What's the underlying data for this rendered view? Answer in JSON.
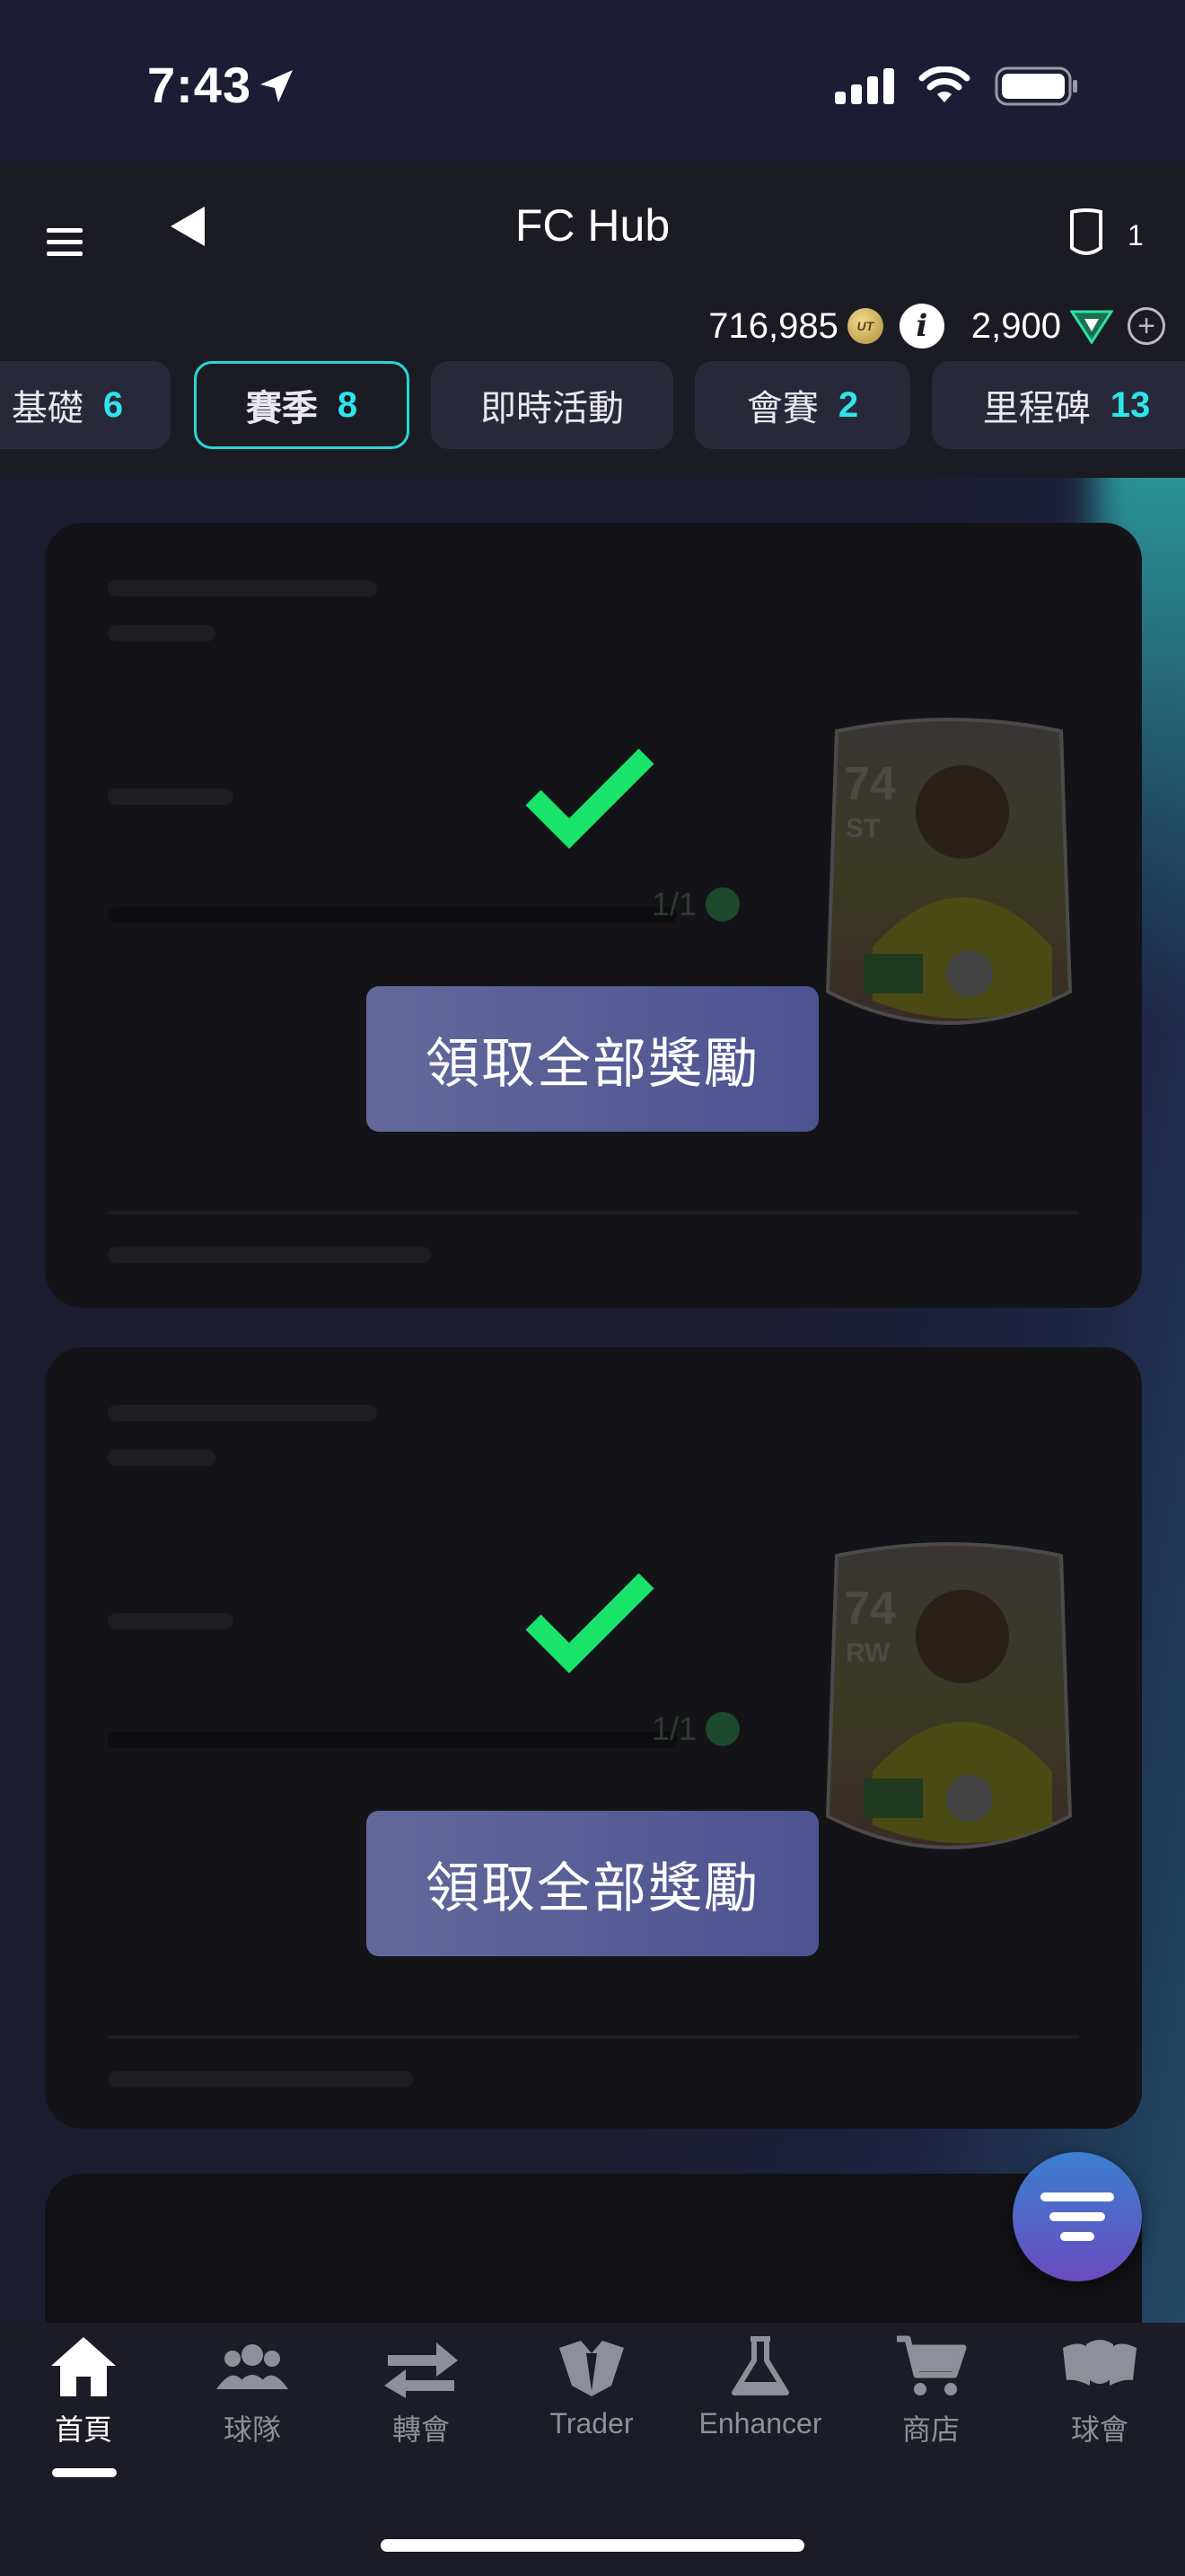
{
  "status_bar": {
    "time": "7:43"
  },
  "header": {
    "title": "FC Hub",
    "shield_count": "1"
  },
  "currency": {
    "coins": "716,985",
    "points": "2,900",
    "coin_icon_text": "UT"
  },
  "tabs": [
    {
      "label": "基礎",
      "count": "6"
    },
    {
      "label": "賽季",
      "count": "8"
    },
    {
      "label": "即時活動",
      "count": ""
    },
    {
      "label": "會賽",
      "count": "2"
    },
    {
      "label": "里程碑",
      "count": "13"
    }
  ],
  "cards": [
    {
      "progress": "1/1",
      "player_rating": "74",
      "player_position": "ST",
      "claim_label": "領取全部獎勵",
      "completed": true
    },
    {
      "progress": "1/1",
      "player_rating": "74",
      "player_position": "RW",
      "claim_label": "領取全部獎勵",
      "completed": true
    }
  ],
  "nav": [
    {
      "label": "首頁",
      "icon": "home-icon"
    },
    {
      "label": "球隊",
      "icon": "squad-icon"
    },
    {
      "label": "轉會",
      "icon": "transfer-icon"
    },
    {
      "label": "Trader",
      "icon": "trader-icon"
    },
    {
      "label": "Enhancer",
      "icon": "enhancer-icon"
    },
    {
      "label": "商店",
      "icon": "store-icon"
    },
    {
      "label": "球會",
      "icon": "club-icon"
    }
  ],
  "colors": {
    "accent": "#2ee5ea",
    "check": "#19e36a",
    "button": "#565d95"
  }
}
